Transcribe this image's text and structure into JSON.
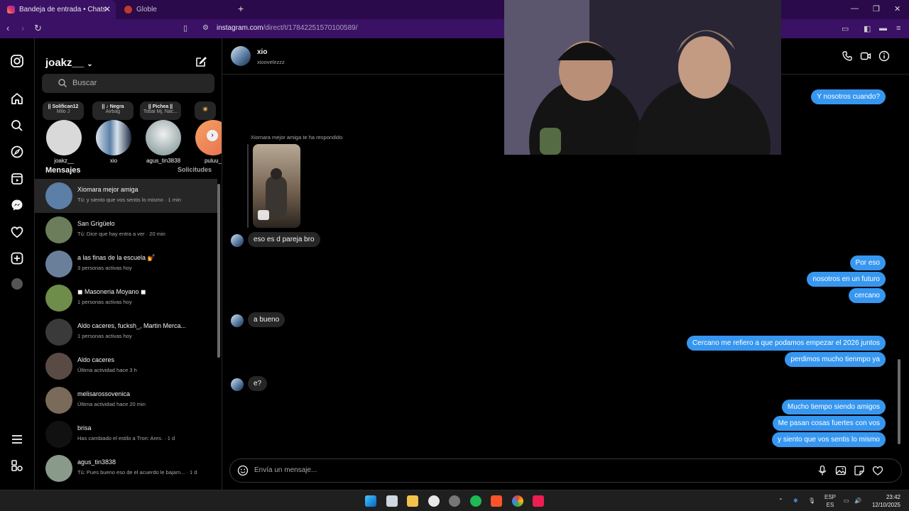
{
  "browser": {
    "active_tab": "Bandeja de entrada • Chats",
    "other_tab": "Globle",
    "url_host": "instagram.com",
    "url_path": "/direct/t/17842251570100589/"
  },
  "sidebar": {
    "username": "joakz__",
    "search_placeholder": "Buscar",
    "notes": [
      {
        "line1": "|| Solifican12",
        "line2": "Milo J"
      },
      {
        "line1": "|| ♪ Negra",
        "line2": "Airbag"
      },
      {
        "line1": "|| Pichea ||",
        "line2": "Tobai Mj, Nac..."
      }
    ],
    "stories": [
      {
        "name": "joakz__"
      },
      {
        "name": "xio"
      },
      {
        "name": "agus_tin3838"
      },
      {
        "name": "puluu_"
      }
    ],
    "section_title": "Mensajes",
    "requests_link": "Solicitudes",
    "conversations": [
      {
        "name": "Xiomara mejor amiga",
        "preview": "Tú: y siento que vos sentis lo mismo · 1 min",
        "color": "#5b7fa6"
      },
      {
        "name": "San Grigüelo",
        "preview": "Tú: Dice que hay entra a ver · 20 min",
        "color": "#6b7d5a"
      },
      {
        "name": "a las finas de la escuela 💅",
        "preview": "3 personas activas hoy",
        "color": "#6a7f9a"
      },
      {
        "name": "◼ Masoneria Moyano ◼",
        "preview": "1 personas activas hoy",
        "color": "#6e8c4a"
      },
      {
        "name": "Aldo caceres, fucksh_, Martin Merca...",
        "preview": "1 personas activas hoy",
        "color": "#3a3a3a"
      },
      {
        "name": "Aldo caceres",
        "preview": "Última actividad hace 3 h",
        "color": "#5a4a44"
      },
      {
        "name": "melisarossovenica",
        "preview": "Última actividad hace 20 min",
        "color": "#7a6a5a"
      },
      {
        "name": "brisa",
        "preview": "Has cambiado el estilo a Tron: Ares. · 1 d",
        "color": "#111111"
      },
      {
        "name": "agus_tin3838",
        "preview": "Tú: Pues bueno eso de el acuerdo le bajam... · 1 d",
        "color": "#8a9a8a"
      }
    ]
  },
  "chat": {
    "contact_name": "xio",
    "contact_username": "xioovelezzz",
    "reply_note": "Xiomara mejor amiga te ha respondido",
    "messages_in": [
      {
        "text": "eso es d pareja bro"
      },
      {
        "text": "a bueno"
      },
      {
        "text": "e?"
      }
    ],
    "messages_out": [
      {
        "text": "Y nosotros cuando?"
      },
      {
        "text": "Por eso"
      },
      {
        "text": "nosotros en un futuro"
      },
      {
        "text": "cercano"
      },
      {
        "text": "Cercano me refiero a que podamos empezar el 2026 juntos"
      },
      {
        "text": "perdimos mucho tienmpo ya"
      },
      {
        "text": "Mucho tiempo siendo amigos"
      },
      {
        "text": "Me pasan cosas fuertes con vos"
      },
      {
        "text": "y siento que vos sentis lo mismo"
      }
    ],
    "composer_placeholder": "Envía un mensaje..."
  },
  "taskbar": {
    "lang": "ESP",
    "region": "ES",
    "time": "23:42",
    "date": "12/10/2025"
  },
  "colors": {
    "accent_blue": "#3797f0",
    "bubble_in": "#262626",
    "browser_purple": "#3b1166"
  }
}
